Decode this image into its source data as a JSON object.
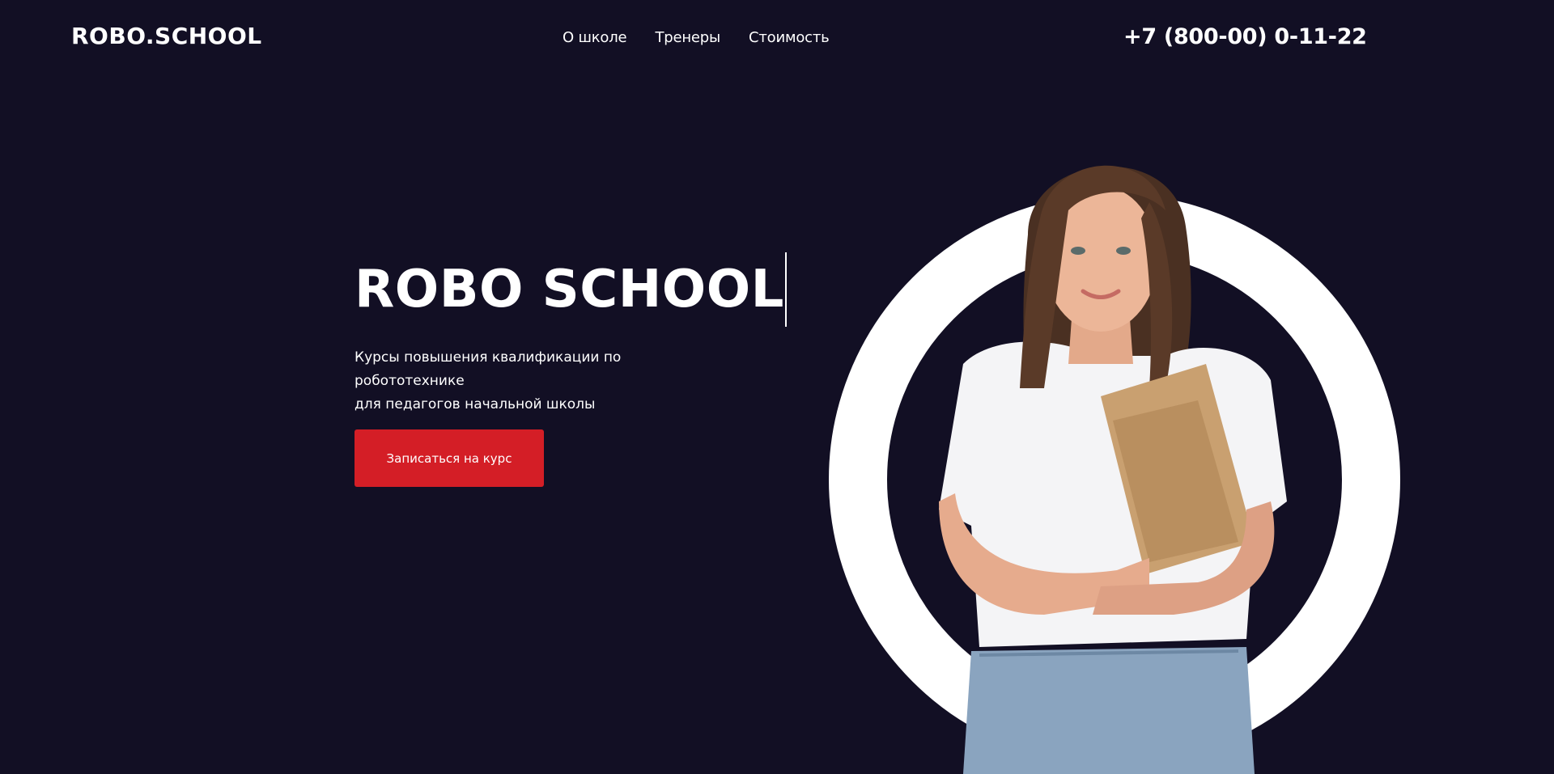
{
  "header": {
    "logo": "ROBO.SCHOOL",
    "nav": [
      "О школе",
      "Тренеры",
      "Стоимость"
    ],
    "phone": "+7 (800-00) 0-11-22"
  },
  "hero": {
    "title": "ROBO SCHOOL",
    "subtitle_line1": "Курсы повышения квалификации по робототехнике",
    "subtitle_line2": "для педагогов начальной школы",
    "cta_label": "Записаться на курс"
  },
  "colors": {
    "background": "#120f24",
    "accent": "#d41e26",
    "text": "#ffffff"
  }
}
